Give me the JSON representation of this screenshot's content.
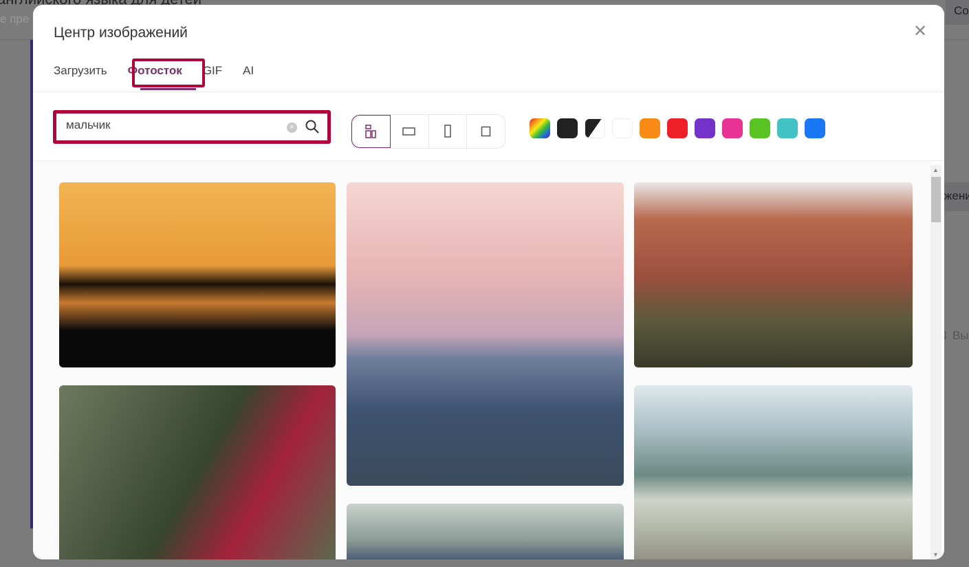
{
  "background": {
    "title_fragment": "английского языка для детей",
    "subtitle_fragment": "е пре",
    "button_fragment": "Со",
    "row_fragment": "жени",
    "row2_fragment": "Вы"
  },
  "modal": {
    "title": "Центр изображений",
    "close_icon": "close-icon",
    "tabs": [
      {
        "label": "Загрузить"
      },
      {
        "label": "Фотосток",
        "active": true
      },
      {
        "label": "GIF"
      },
      {
        "label": "AI"
      }
    ],
    "search": {
      "value": "мальчик"
    },
    "layout_options": [
      {
        "name": "all",
        "selected": true
      },
      {
        "name": "horizontal"
      },
      {
        "name": "vertical"
      },
      {
        "name": "square"
      }
    ],
    "color_filters": [
      "rainbow",
      "#222222",
      "black-white",
      "#ffffff",
      "#f78b16",
      "#ee2027",
      "#7333c9",
      "#e93394",
      "#58c322",
      "#44c2c3",
      "#1a78f5"
    ],
    "images": [
      {
        "subject": "boy cycling silhouette at sunset"
      },
      {
        "subject": "man photographing city at dusk"
      },
      {
        "subject": "hiker with backpack facing red cliffs"
      },
      {
        "subject": "young man in floral shirt"
      },
      {
        "subject": "couple on bench"
      },
      {
        "subject": "man standing by mountain lake"
      }
    ]
  }
}
